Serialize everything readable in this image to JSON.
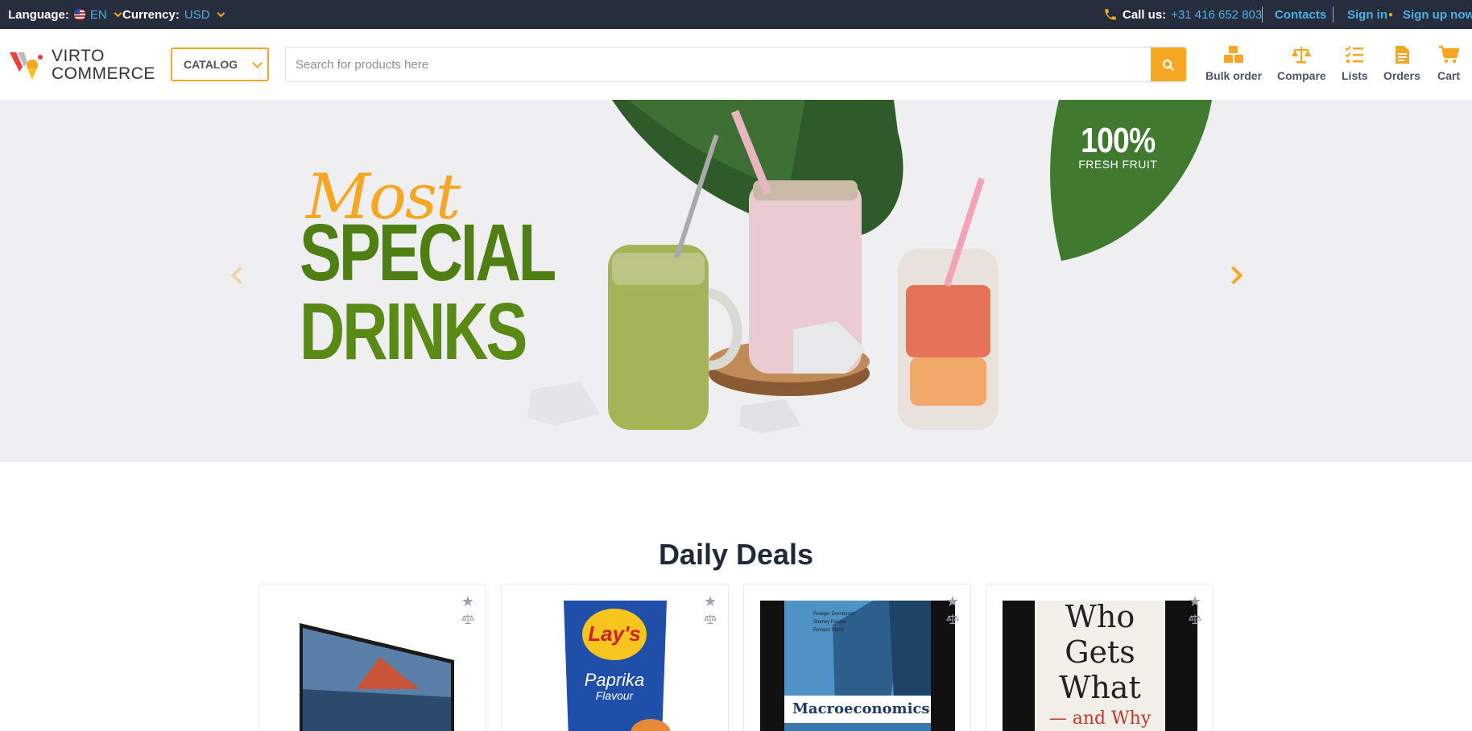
{
  "topbar": {
    "language_label": "Language:",
    "language_value": "EN",
    "currency_label": "Currency:",
    "currency_value": "USD",
    "call_label": "Call us:",
    "phone": "+31 416 652 803",
    "contacts": "Contacts",
    "sign_in": "Sign in",
    "sign_up": "Sign up now"
  },
  "header": {
    "logo_line1": "VIRTO",
    "logo_line2": "COMMERCE",
    "catalog": "CATALOG",
    "search_placeholder": "Search for products here",
    "nav": [
      {
        "label": "Bulk order",
        "icon": "bulk-order-icon"
      },
      {
        "label": "Compare",
        "icon": "compare-icon"
      },
      {
        "label": "Lists",
        "icon": "lists-icon"
      },
      {
        "label": "Orders",
        "icon": "orders-icon"
      },
      {
        "label": "Cart",
        "icon": "cart-icon"
      }
    ]
  },
  "banner": {
    "script_word": "Most",
    "headline_1": "SPECIAL",
    "headline_2": "DRINKS",
    "badge_pct": "100%",
    "badge_text": "FRESH FRUIT"
  },
  "deals": {
    "title": "Daily Deals",
    "products": [
      {
        "image": "tv-image"
      },
      {
        "image": "chips-image",
        "brand": "Lay's",
        "flavor_1": "Paprika",
        "flavor_2": "Flavour"
      },
      {
        "image": "book-macroeconomics-image",
        "authors": [
          "Rudiger Dornbusch",
          "Stanley Fischer",
          "Richard Startz"
        ],
        "title": "Macroeconomics"
      },
      {
        "image": "book-who-gets-what-image",
        "line1": "Who",
        "line2": "Gets",
        "line3": "What",
        "line4": "— and Why"
      }
    ]
  },
  "colors": {
    "accent": "#f5a623",
    "topbar_bg": "#262d3d",
    "link": "#4fb0e6",
    "banner_bg": "#efeff1",
    "headline_green": "#4f7e12"
  }
}
